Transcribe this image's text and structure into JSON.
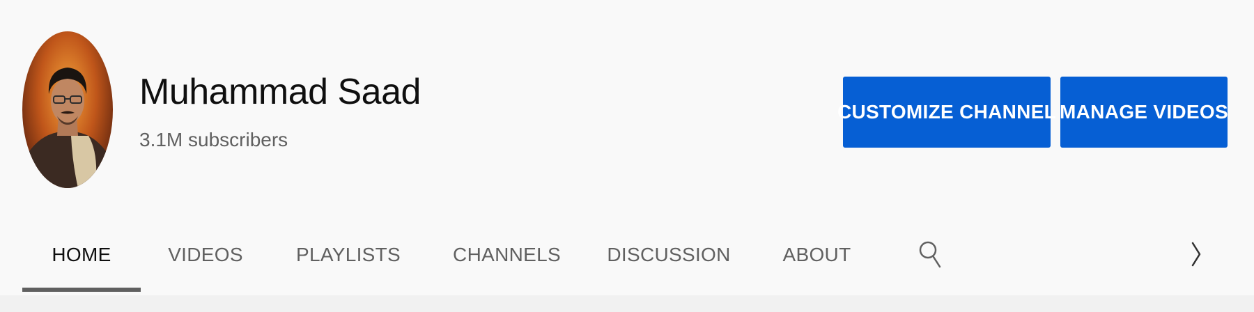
{
  "channel": {
    "name": "Muhammad Saad",
    "subscribers": "3.1M subscribers",
    "avatar_icon": "channel-avatar"
  },
  "actions": {
    "customize_label": "CUSTOMIZE CHANNEL",
    "manage_label": "MANAGE VIDEOS",
    "button_color": "#065fd4"
  },
  "tabs": [
    {
      "label": "HOME",
      "active": true
    },
    {
      "label": "VIDEOS",
      "active": false
    },
    {
      "label": "PLAYLISTS",
      "active": false
    },
    {
      "label": "CHANNELS",
      "active": false
    },
    {
      "label": "DISCUSSION",
      "active": false
    },
    {
      "label": "ABOUT",
      "active": false
    }
  ],
  "tab_icons": {
    "search": "search-icon",
    "next": "chevron-right-icon"
  },
  "colors": {
    "background": "#f9f9f9",
    "text_primary": "#0f0f0f",
    "text_secondary": "#606060",
    "underline": "#606060"
  }
}
